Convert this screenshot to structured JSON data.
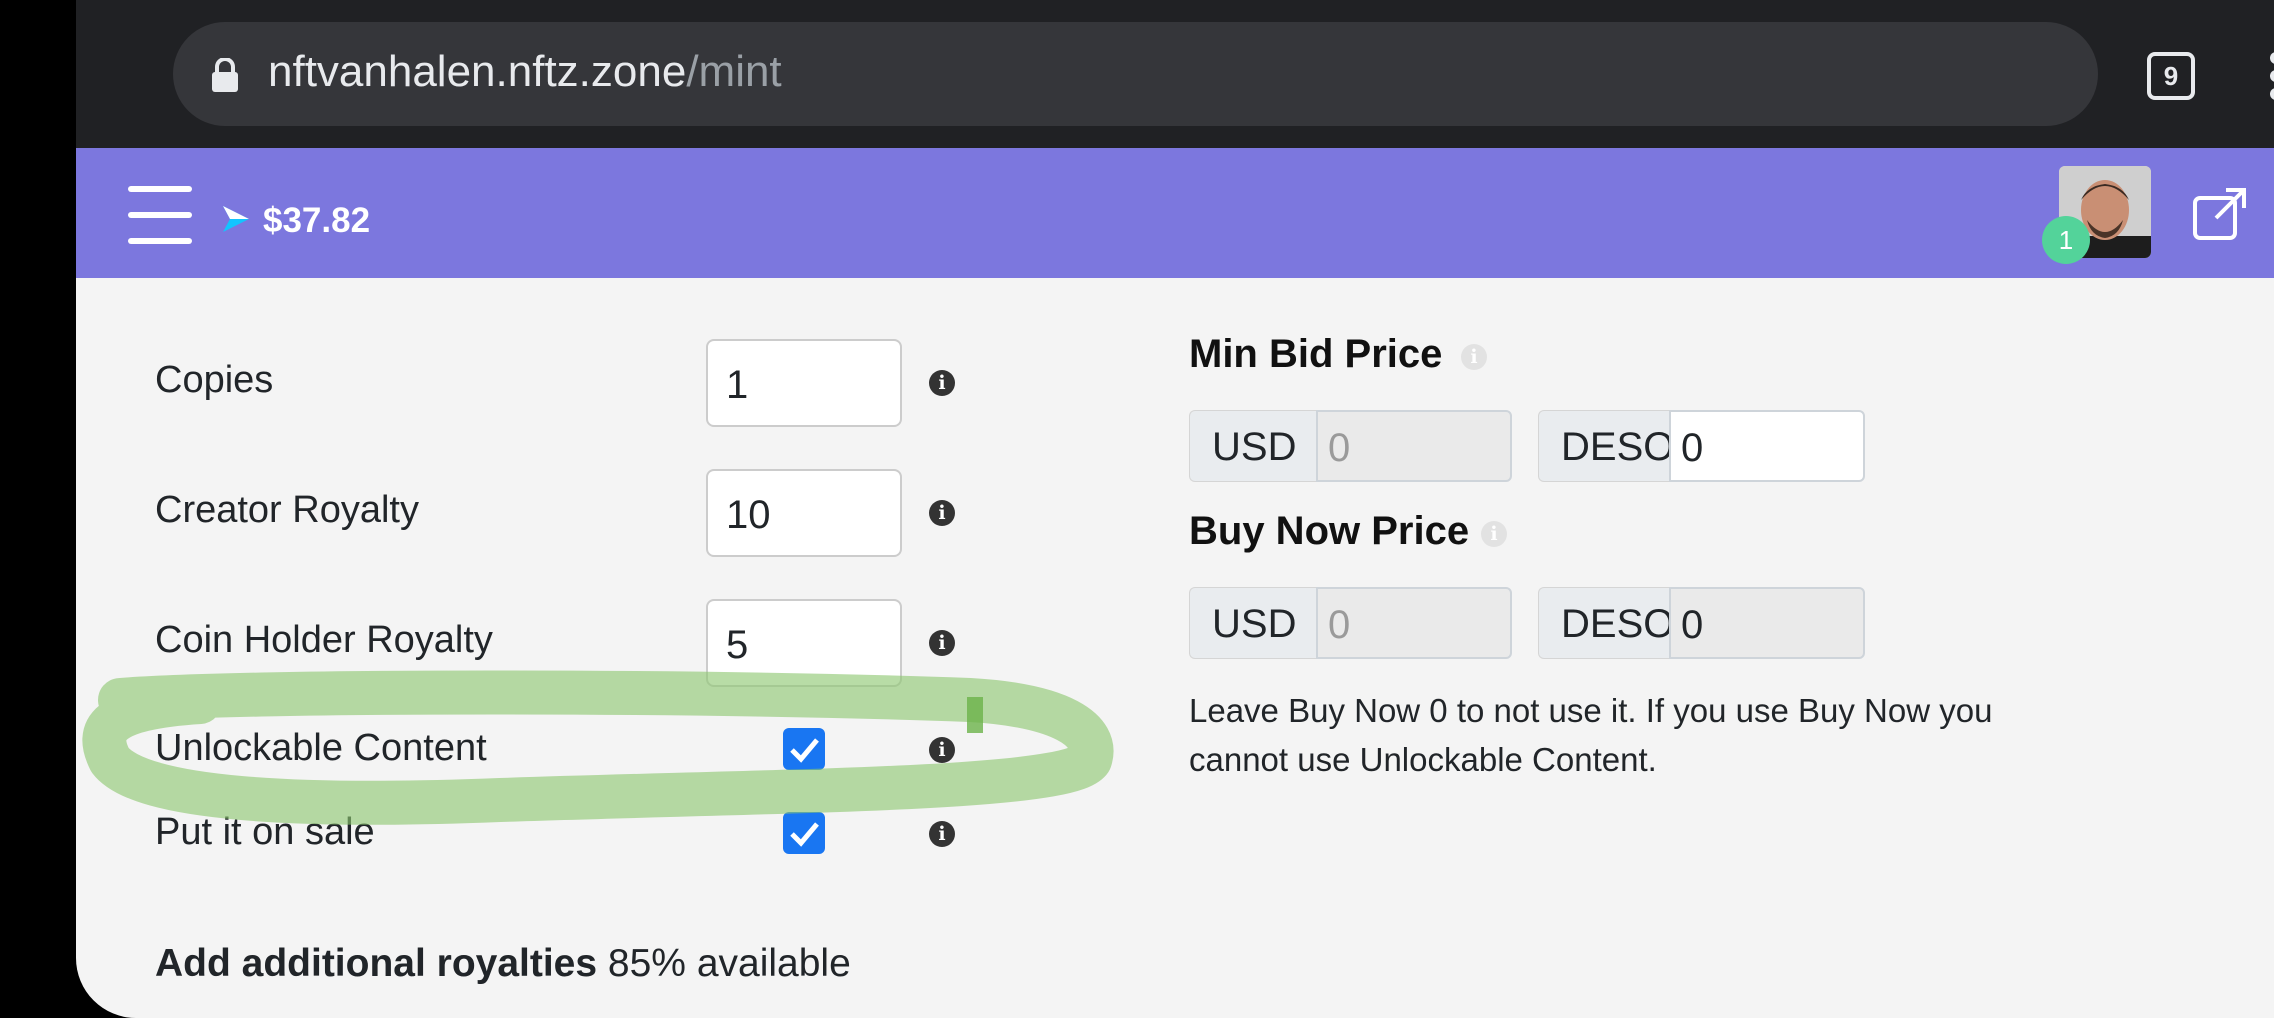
{
  "browser": {
    "url_host": "nftvanhalen.nftz.zone",
    "url_path": "/mint",
    "tab_count": "9",
    "icons": [
      "lock-icon",
      "tab-switcher-icon",
      "more-options-icon"
    ]
  },
  "nav": {
    "balance": "$37.82",
    "notification_count": "1",
    "icons": [
      "hamburger-menu-icon",
      "deso-logo-icon",
      "external-link-icon"
    ]
  },
  "form": {
    "copies": {
      "label": "Copies",
      "value": "1"
    },
    "creator_royalty": {
      "label": "Creator Royalty",
      "value": "10"
    },
    "coin_holder_royalty": {
      "label": "Coin Holder Royalty",
      "value": "5"
    },
    "unlockable_content": {
      "label": "Unlockable Content",
      "checked": true
    },
    "put_on_sale": {
      "label": "Put it on sale",
      "checked": true
    },
    "info_glyph": "i"
  },
  "pricing": {
    "min_bid": {
      "title": "Min Bid Price",
      "usd_label": "USD",
      "usd_placeholder": "0",
      "deso_label": "DESO",
      "deso_value": "0"
    },
    "buy_now": {
      "title": "Buy Now Price",
      "usd_label": "USD",
      "usd_placeholder": "0",
      "deso_label": "DESO",
      "deso_value": "0"
    },
    "note": "Leave Buy Now 0 to not use it. If you use Buy Now you cannot use Unlockable Content."
  },
  "royalties": {
    "title": "Add additional royalties",
    "available": "85% available"
  },
  "colors": {
    "nav": "#7c77de",
    "checkbox": "#1976f2",
    "badge": "#53d39a",
    "highlight": "#8dc66f"
  }
}
